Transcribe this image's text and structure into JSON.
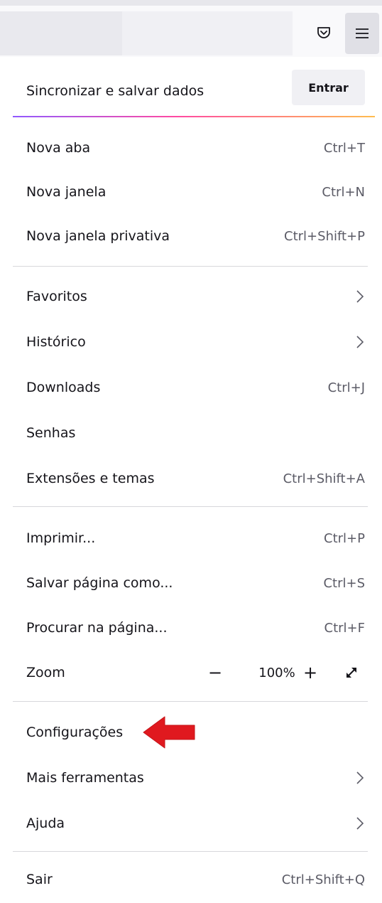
{
  "toolbar": {
    "pocket_icon": "pocket-icon",
    "menu_icon": "hamburger-menu-icon"
  },
  "sync": {
    "label": "Sincronizar e salvar dados",
    "signin_label": "Entrar"
  },
  "menu": {
    "new_tab": {
      "label": "Nova aba",
      "shortcut": "Ctrl+T"
    },
    "new_window": {
      "label": "Nova janela",
      "shortcut": "Ctrl+N"
    },
    "new_private_window": {
      "label": "Nova janela privativa",
      "shortcut": "Ctrl+Shift+P"
    },
    "bookmarks": {
      "label": "Favoritos"
    },
    "history": {
      "label": "Histórico"
    },
    "downloads": {
      "label": "Downloads",
      "shortcut": "Ctrl+J"
    },
    "passwords": {
      "label": "Senhas"
    },
    "addons": {
      "label": "Extensões e temas",
      "shortcut": "Ctrl+Shift+A"
    },
    "print": {
      "label": "Imprimir...",
      "shortcut": "Ctrl+P"
    },
    "save_page": {
      "label": "Salvar página como...",
      "shortcut": "Ctrl+S"
    },
    "find": {
      "label": "Procurar na página...",
      "shortcut": "Ctrl+F"
    },
    "zoom": {
      "label": "Zoom",
      "minus": "−",
      "value": "100%",
      "plus": "+"
    },
    "settings": {
      "label": "Configurações"
    },
    "more_tools": {
      "label": "Mais ferramentas"
    },
    "help": {
      "label": "Ajuda"
    },
    "quit": {
      "label": "Sair",
      "shortcut": "Ctrl+Shift+Q"
    }
  },
  "annotation": {
    "arrow_color": "#e0191f"
  }
}
